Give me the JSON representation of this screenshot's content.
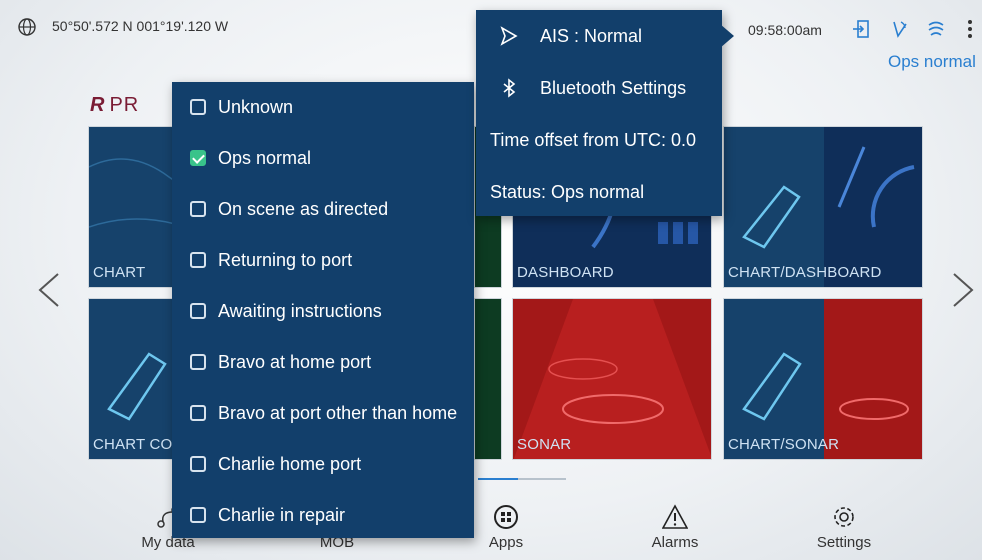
{
  "status_bar": {
    "coordinates": "50°50'.572 N   001°19'.120 W",
    "time": "09:58:00am",
    "ais_status": "Ops normal"
  },
  "brand": {
    "logo": "R",
    "text": "PR"
  },
  "tiles": [
    {
      "label": "CHART"
    },
    {
      "label": "DASHBOARD"
    },
    {
      "label": "CHART/DASHBOARD"
    },
    {
      "label": "CHART CO"
    },
    {
      "label": "SONAR"
    },
    {
      "label": "CHART/SONAR"
    }
  ],
  "bottom_nav": [
    {
      "label": "My data"
    },
    {
      "label": "MOB"
    },
    {
      "label": "Apps"
    },
    {
      "label": "Alarms"
    },
    {
      "label": "Settings"
    }
  ],
  "status_menu": {
    "items": [
      {
        "label": "Unknown",
        "checked": false
      },
      {
        "label": "Ops normal",
        "checked": true
      },
      {
        "label": "On scene as directed",
        "checked": false
      },
      {
        "label": "Returning to port",
        "checked": false
      },
      {
        "label": "Awaiting instructions",
        "checked": false
      },
      {
        "label": "Bravo at home port",
        "checked": false
      },
      {
        "label": "Bravo at port other than home",
        "checked": false
      },
      {
        "label": "Charlie home port",
        "checked": false
      },
      {
        "label": "Charlie in repair",
        "checked": false
      }
    ]
  },
  "ais_popover": {
    "mode": "AIS : Normal",
    "bluetooth": "Bluetooth Settings",
    "time_offset": "Time offset from UTC: 0.0",
    "status": "Status: Ops normal"
  },
  "colors": {
    "menu_bg": "#123f6b",
    "accent": "#2a7fd0",
    "check": "#39c38a",
    "brand": "#7a1c34"
  }
}
